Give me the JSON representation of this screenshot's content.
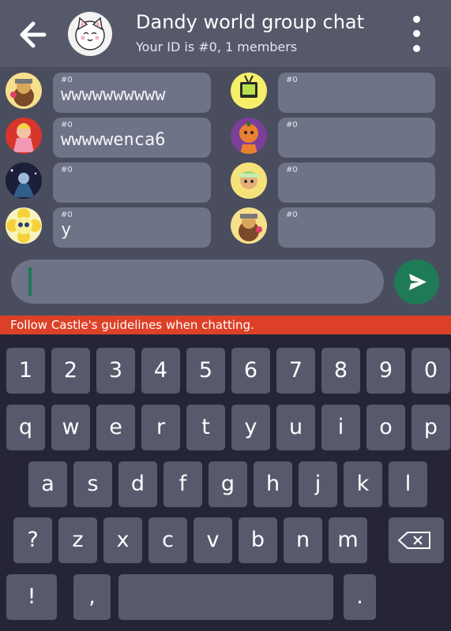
{
  "header": {
    "title": "Dandy world group chat",
    "subtitle": "Your ID is #0, 1 members",
    "back_icon": "arrow-left-icon",
    "menu_icon": "more-vertical-icon"
  },
  "messages": {
    "left": [
      {
        "id": "#0",
        "text": "wwwwwwwwww",
        "avatar_color": "#d9a65a"
      },
      {
        "id": "#0",
        "text": "wwwwwenca6",
        "avatar_color": "#e88b7a"
      },
      {
        "id": "#0",
        "text": "",
        "avatar_color": "#3a3d68"
      },
      {
        "id": "#0",
        "text": "y",
        "avatar_color": "#f5dc3a"
      }
    ],
    "right": [
      {
        "id": "#0",
        "text": "",
        "avatar_color": "#c6e04f"
      },
      {
        "id": "#0",
        "text": "",
        "avatar_color": "#8a4ba0"
      },
      {
        "id": "#0",
        "text": "",
        "avatar_color": "#9fd67a"
      },
      {
        "id": "#0",
        "text": "",
        "avatar_color": "#e7c54a"
      }
    ]
  },
  "composer": {
    "send_icon": "send-icon"
  },
  "guideline": "Follow Castle's guidelines when chatting.",
  "keyboard": {
    "row1": [
      "1",
      "2",
      "3",
      "4",
      "5",
      "6",
      "7",
      "8",
      "9",
      "0"
    ],
    "row2": [
      "q",
      "w",
      "e",
      "r",
      "t",
      "y",
      "u",
      "i",
      "o",
      "p"
    ],
    "row3": [
      "a",
      "s",
      "d",
      "f",
      "g",
      "h",
      "j",
      "k",
      "l"
    ],
    "row4": [
      "?",
      "z",
      "x",
      "c",
      "v",
      "b",
      "n",
      "m"
    ],
    "row5": [
      "!",
      ",",
      "."
    ],
    "backspace_icon": "backspace-icon"
  },
  "colors": {
    "accent": "#1f7a57",
    "warning": "#dc4127"
  }
}
